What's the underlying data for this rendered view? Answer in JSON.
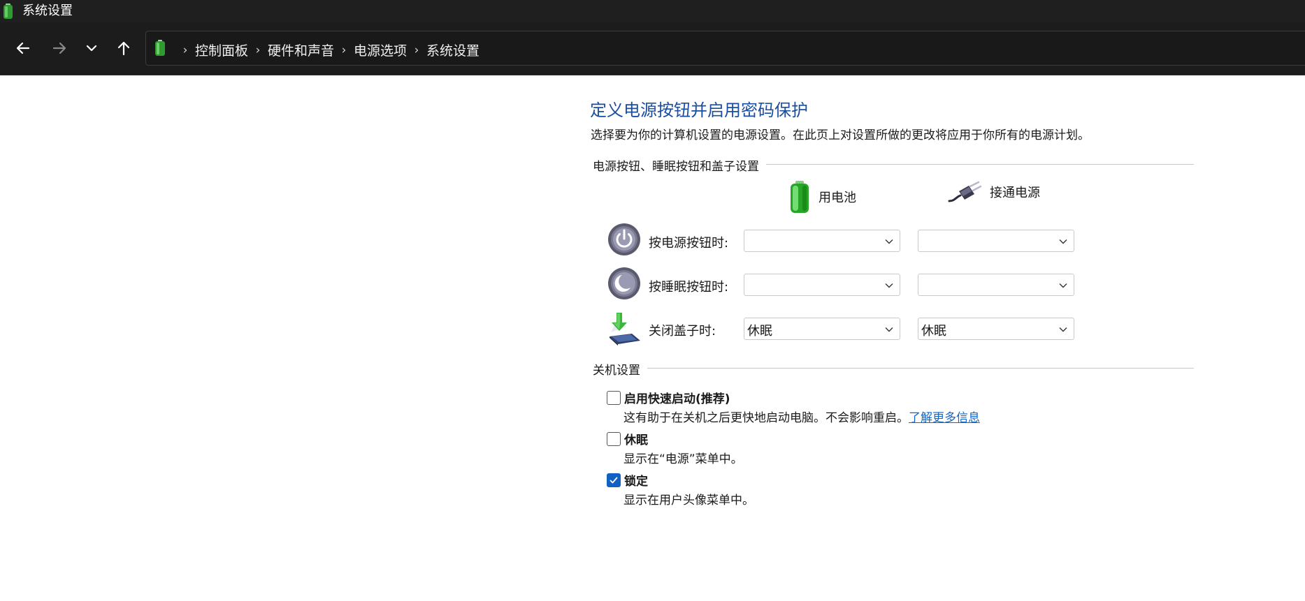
{
  "window": {
    "title": "系统设置"
  },
  "nav": {
    "back_icon": "arrow-left-icon",
    "forward_icon": "arrow-right-icon",
    "recent_icon": "chevron-down-icon",
    "up_icon": "arrow-up-icon",
    "breadcrumb": [
      "控制面板",
      "硬件和声音",
      "电源选项",
      "系统设置"
    ],
    "separator": "›"
  },
  "page": {
    "title": "定义电源按钮并启用密码保护",
    "description": "选择要为你的计算机设置的电源设置。在此页上对设置所做的更改将应用于你所有的电源计划。"
  },
  "buttons_section": {
    "heading": "电源按钮、睡眠按钮和盖子设置",
    "columns": [
      {
        "label": "用电池",
        "icon": "battery-icon"
      },
      {
        "label": "接通电源",
        "icon": "power-plug-icon"
      }
    ],
    "rows": [
      {
        "label": "按电源按钮时:",
        "icon": "power-button-icon",
        "battery_value": "",
        "plugged_value": ""
      },
      {
        "label": "按睡眠按钮时:",
        "icon": "sleep-button-icon",
        "battery_value": "",
        "plugged_value": ""
      },
      {
        "label": "关闭盖子时:",
        "icon": "laptop-lid-icon",
        "battery_value": "休眠",
        "plugged_value": "休眠"
      }
    ]
  },
  "shutdown_section": {
    "heading": "关机设置",
    "options": [
      {
        "label": "启用快速启动(推荐)",
        "checked": false,
        "description": "这有助于在关机之后更快地启动电脑。不会影响重启。",
        "link": "了解更多信息"
      },
      {
        "label": "休眠",
        "checked": false,
        "description": "显示在“电源”菜单中。"
      },
      {
        "label": "锁定",
        "checked": true,
        "description": "显示在用户头像菜单中。"
      }
    ]
  },
  "colors": {
    "title_blue": "#1a4ea2",
    "link_blue": "#1166cc",
    "checkbox_blue": "#1160c3",
    "titlebar": "#1f1f1f"
  }
}
